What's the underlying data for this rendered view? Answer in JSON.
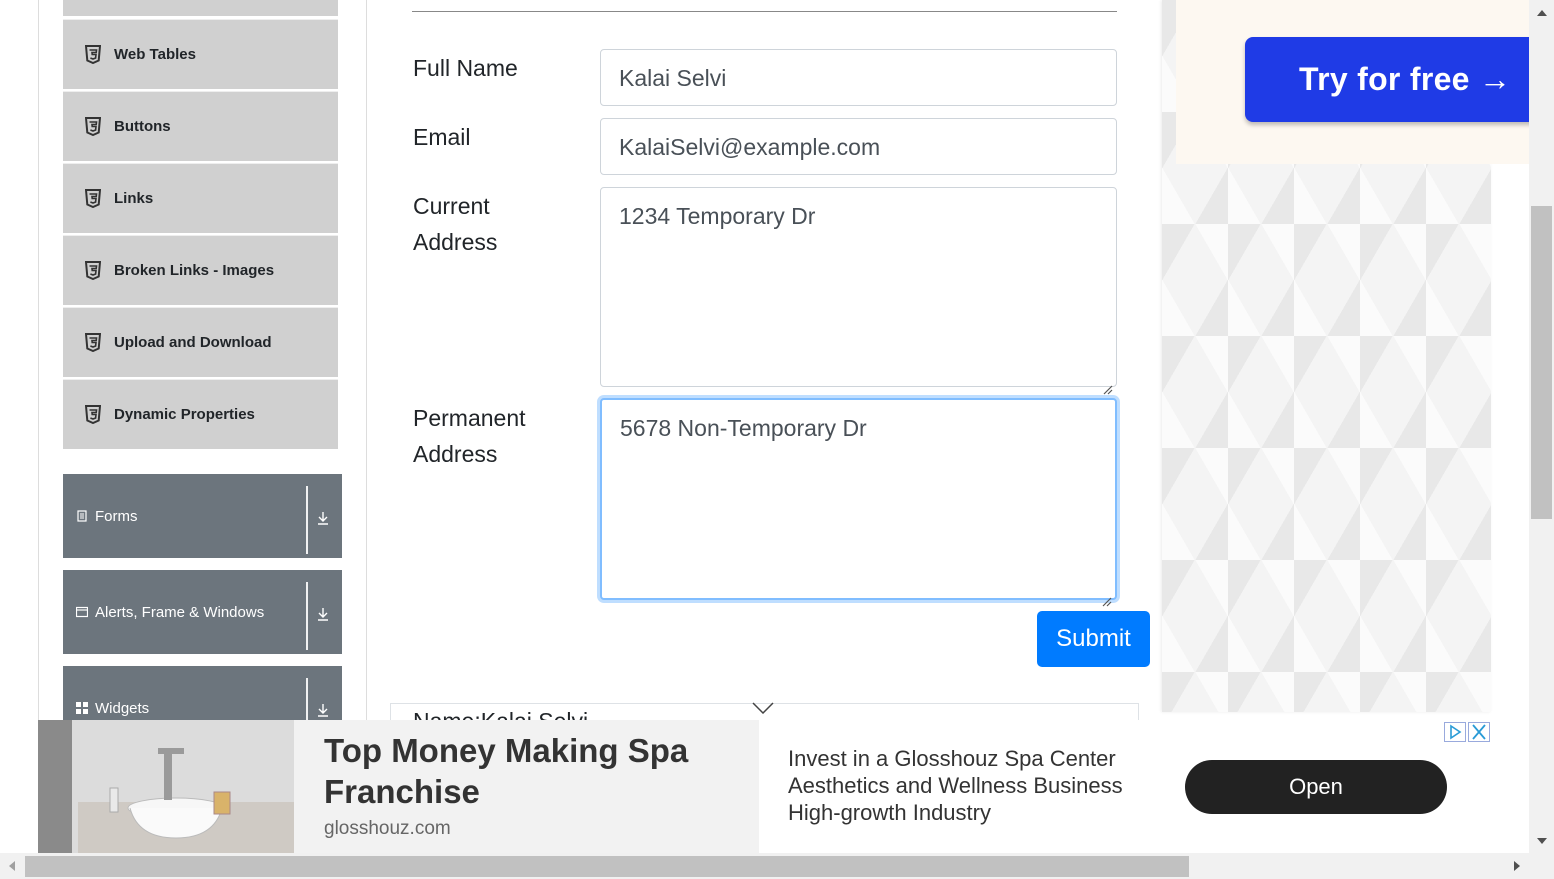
{
  "sidebar": {
    "elements_items": [
      {
        "label": "Web Tables"
      },
      {
        "label": "Buttons"
      },
      {
        "label": "Links"
      },
      {
        "label": "Broken Links - Images"
      },
      {
        "label": "Upload and Download"
      },
      {
        "label": "Dynamic Properties"
      }
    ],
    "groups": [
      {
        "label": "Forms",
        "icon": "form-icon"
      },
      {
        "label": "Alerts, Frame & Windows",
        "icon": "window-icon"
      },
      {
        "label": "Widgets",
        "icon": "widgets-icon"
      }
    ]
  },
  "form": {
    "full_name_label": "Full Name",
    "full_name_value": "Kalai Selvi",
    "email_label": "Email",
    "email_value": "KalaiSelvi@example.com",
    "current_address_label_line1": "Current",
    "current_address_label_line2": "Address",
    "current_address_value": "1234 Temporary Dr",
    "permanent_address_label_line1": "Permanent",
    "permanent_address_label_line2": "Address",
    "permanent_address_value": "5678 Non-Temporary Dr",
    "submit_label": "Submit"
  },
  "output": {
    "name_line": "Name:Kalai Selvi"
  },
  "right_ad": {
    "cta": "Try for free →"
  },
  "banner": {
    "title": "Top Money Making Spa Franchise",
    "domain": "glosshouz.com",
    "description": "Invest in a Glosshouz Spa Center Aesthetics and Wellness Business High-growth Industry",
    "open_label": "Open"
  },
  "colors": {
    "primary": "#007bff",
    "sidebar_item_bg": "#d0d0d0",
    "group_bg": "#6c757d",
    "ad_button": "#1f3be6"
  }
}
